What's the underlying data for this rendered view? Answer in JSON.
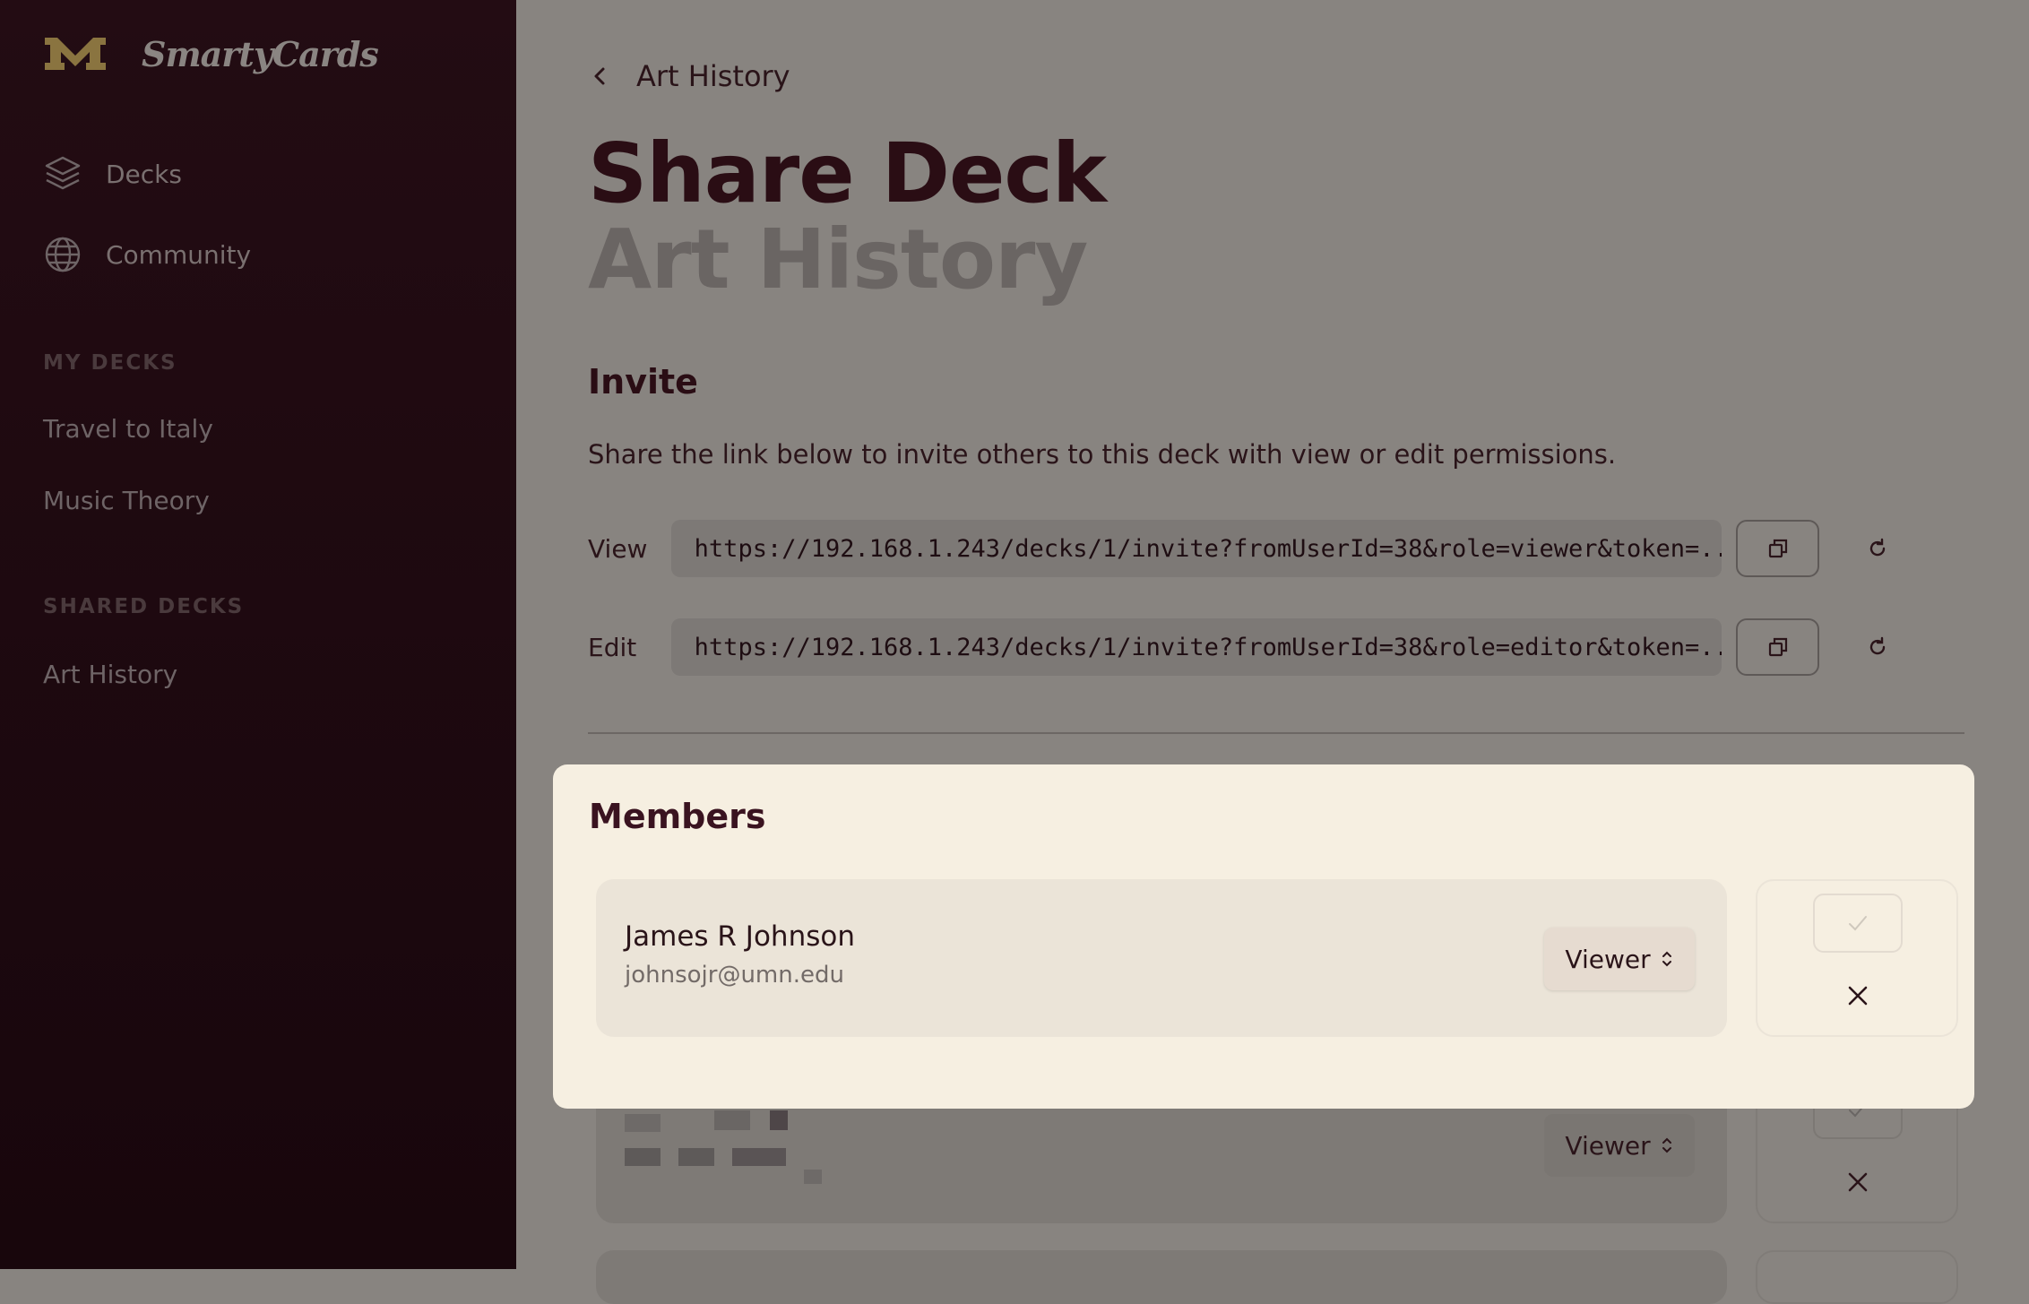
{
  "brand": {
    "name": "SmartyCards"
  },
  "sidebar": {
    "nav": [
      {
        "label": "Decks",
        "icon": "layers-icon"
      },
      {
        "label": "Community",
        "icon": "globe-icon"
      }
    ],
    "my_decks_label": "MY DECKS",
    "my_decks": [
      "Travel to Italy",
      "Music Theory"
    ],
    "shared_decks_label": "SHARED DECKS",
    "shared_decks": [
      "Art History"
    ]
  },
  "header": {
    "back_label": "Art History",
    "title": "Share Deck",
    "subtitle": "Art History"
  },
  "invite": {
    "heading": "Invite",
    "description": "Share the link below to invite others to this deck with view or edit permissions.",
    "view_label": "View",
    "view_link": "https://192.168.1.243/decks/1/invite?fromUserId=38&role=viewer&token=...",
    "edit_label": "Edit",
    "edit_link": "https://192.168.1.243/decks/1/invite?fromUserId=38&role=editor&token=..."
  },
  "members": {
    "heading": "Members",
    "items": [
      {
        "name": "James R Johnson",
        "email": "johnsojr@umn.edu",
        "role": "Viewer"
      },
      {
        "name": "",
        "email": "",
        "role": "Viewer"
      }
    ]
  },
  "colors": {
    "sidebar_bg": "#1e0810",
    "accent_gold": "#8a7440",
    "title_color": "#2a0d14",
    "card_bg": "#f6efe1"
  }
}
